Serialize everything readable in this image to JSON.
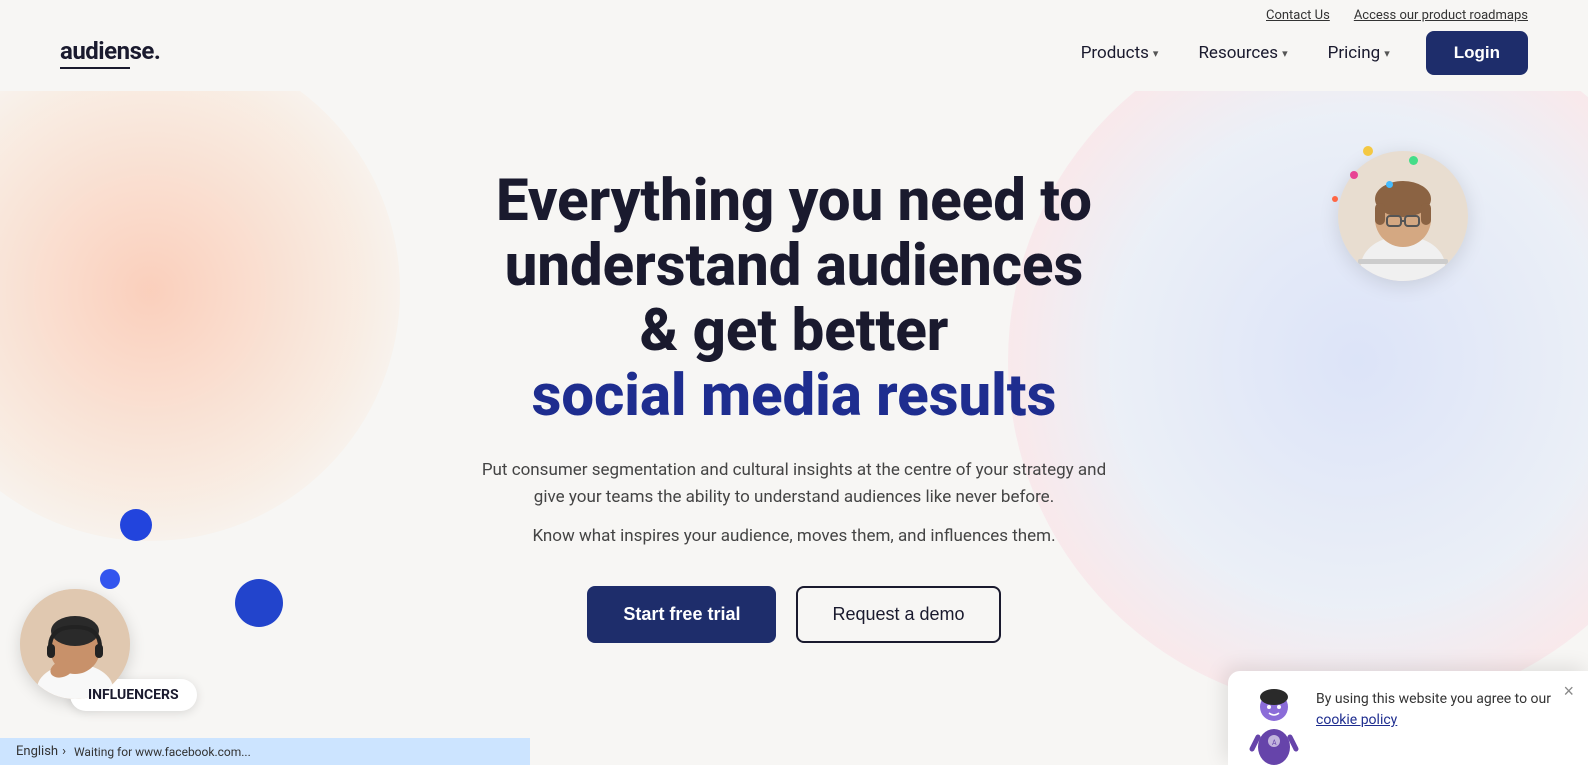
{
  "topbar": {
    "contact_label": "Contact Us",
    "roadmap_label": "Access our product roadmaps"
  },
  "navbar": {
    "logo": "audiense.",
    "products_label": "Products",
    "resources_label": "Resources",
    "pricing_label": "Pricing",
    "login_label": "Login"
  },
  "hero": {
    "title_line1": "Everything you need to",
    "title_line2": "understand audiences",
    "title_line3": "& get better",
    "title_highlight": "social media results",
    "subtitle1": "Put consumer segmentation and cultural insights at the centre of your strategy and give your teams the ability to understand audiences like never before.",
    "subtitle2": "Know what inspires your audience, moves them, and influences them.",
    "cta_primary": "Start free trial",
    "cta_secondary": "Request a demo"
  },
  "influencer_badge": {
    "label": "INFLUENCERS"
  },
  "cookie_banner": {
    "text": "By using this website you agree to our",
    "link_text": "cookie policy",
    "close_label": "×"
  },
  "status_bar": {
    "lang": "English",
    "status": "Waiting for www.facebook.com..."
  },
  "colors": {
    "navy": "#1e2d6b",
    "dark": "#1a1a2e",
    "blue_accent": "#2244dd",
    "highlight_blue": "#1e2d8f"
  }
}
